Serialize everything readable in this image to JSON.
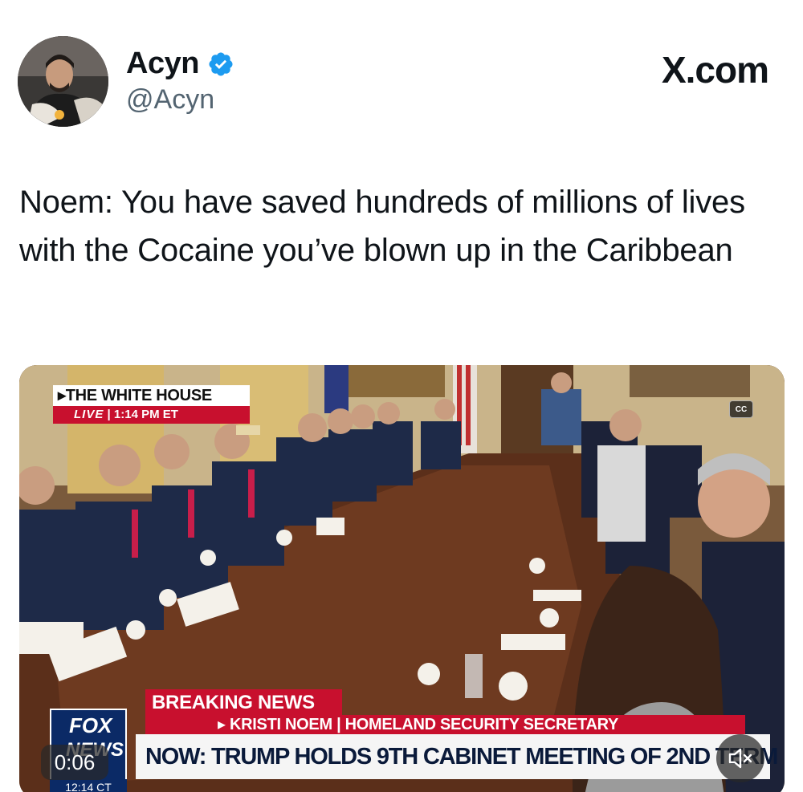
{
  "post": {
    "display_name": "Acyn",
    "handle": "@Acyn",
    "site": "X.com",
    "text": "Noem: You have saved hundreds of millions of lives with the Cocaine you’ve blown up in the Caribbean"
  },
  "video": {
    "location_label": "▸THE WHITE HOUSE",
    "live_label": "LIVE",
    "live_time": "1:14 PM ET",
    "cc_label": "CC",
    "breaking_label": "BREAKING NEWS",
    "speaker_line": "▸ KRISTI NOEM | HOMELAND SECURITY SECRETARY",
    "headline": "NOW: TRUMP HOLDS 9TH CABINET MEETING OF 2ND TERM",
    "network_line1": "FOX",
    "network_line2": "NEWS",
    "network_clock": "12:14 CT",
    "timestamp": "0:06",
    "mute_icon": "speaker-muted-icon"
  },
  "colors": {
    "verified": "#1d9bf0",
    "fox_red": "#c8102e",
    "fox_blue": "#0b2a66",
    "handle_gray": "#536471"
  }
}
